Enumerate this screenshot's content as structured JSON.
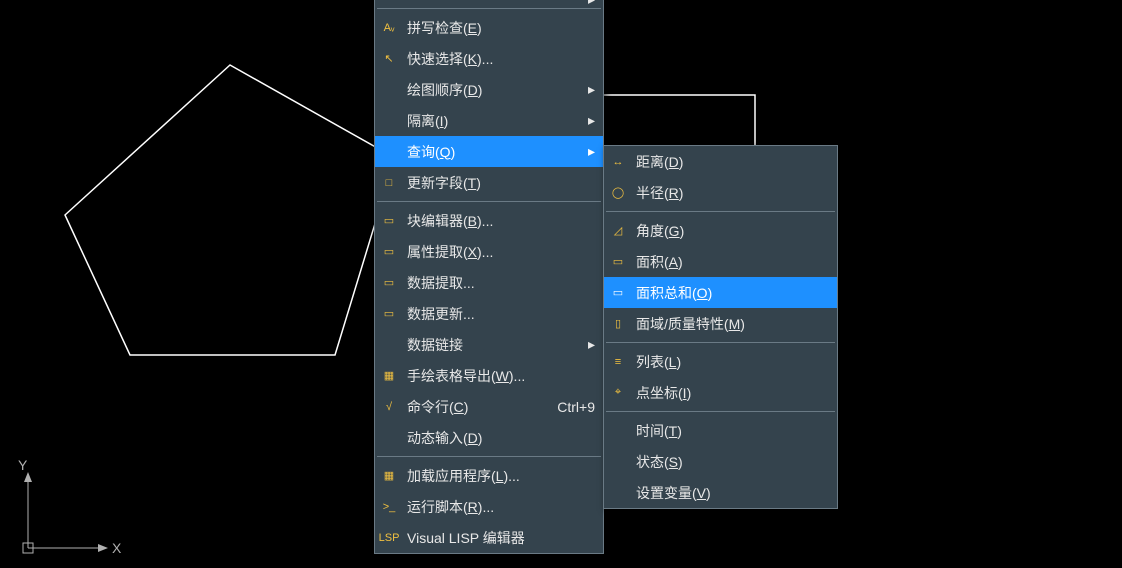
{
  "menu1": {
    "items": [
      {
        "icon": "",
        "label": "",
        "arrow": true,
        "top_cut": true
      },
      {
        "sep": true
      },
      {
        "icon": "spell-check-icon",
        "glyph": "Aᵥ",
        "label": "拼写检查(<u>E</u>)"
      },
      {
        "icon": "quick-select-icon",
        "glyph": "↖",
        "label": "快速选择(<u>K</u>)..."
      },
      {
        "icon": "",
        "label": "绘图顺序(<u>D</u>)",
        "arrow": true
      },
      {
        "icon": "",
        "label": "隔离(<u>I</u>)",
        "arrow": true
      },
      {
        "icon": "",
        "label": "查询(<u>Q</u>)",
        "arrow": true,
        "highlight": true
      },
      {
        "icon": "update-field-icon",
        "glyph": "□",
        "label": "更新字段(<u>T</u>)"
      },
      {
        "sep": true
      },
      {
        "icon": "block-editor-icon",
        "glyph": "▭",
        "label": "块编辑器(<u>B</u>)..."
      },
      {
        "icon": "attribute-extract-icon",
        "glyph": "▭",
        "label": "属性提取(<u>X</u>)..."
      },
      {
        "icon": "data-extract-icon",
        "glyph": "▭",
        "label": "数据提取..."
      },
      {
        "icon": "data-update-icon",
        "glyph": "▭",
        "label": "数据更新..."
      },
      {
        "icon": "",
        "label": "数据链接",
        "arrow": true
      },
      {
        "icon": "table-export-icon",
        "glyph": "▦",
        "label": "手绘表格导出(<u>W</u>)..."
      },
      {
        "icon": "command-line-icon",
        "glyph": "√",
        "label": "命令行(<u>C</u>)",
        "shortcut": "Ctrl+9"
      },
      {
        "icon": "",
        "label": "动态输入(<u>D</u>)"
      },
      {
        "sep": true
      },
      {
        "icon": "load-app-icon",
        "glyph": "▦",
        "label": "加载应用程序(<u>L</u>)..."
      },
      {
        "icon": "run-script-icon",
        "glyph": ">_",
        "label": "运行脚本(<u>R</u>)..."
      },
      {
        "icon": "vlisp-icon",
        "glyph": "LSP",
        "label": "Visual LISP 编辑器"
      }
    ]
  },
  "menu2": {
    "items": [
      {
        "icon": "distance-icon",
        "glyph": "↔",
        "label": "距离(<u>D</u>)"
      },
      {
        "icon": "radius-icon",
        "glyph": "◯",
        "label": "半径(<u>R</u>)"
      },
      {
        "sep": true
      },
      {
        "icon": "angle-icon",
        "glyph": "◿",
        "label": "角度(<u>G</u>)"
      },
      {
        "icon": "area-icon",
        "glyph": "▭",
        "label": "面积(<u>A</u>)"
      },
      {
        "icon": "area-sum-icon",
        "glyph": "▭",
        "label": "面积总和(<u>O</u>)",
        "highlight": true
      },
      {
        "icon": "region-mass-icon",
        "glyph": "▯",
        "label": "面域/质量特性(<u>M</u>)"
      },
      {
        "sep": true
      },
      {
        "icon": "list-icon",
        "glyph": "≡",
        "label": "列表(<u>L</u>)"
      },
      {
        "icon": "point-coord-icon",
        "glyph": "⌖",
        "label": "点坐标(<u>I</u>)"
      },
      {
        "sep": true
      },
      {
        "icon": "",
        "label": "时间(<u>T</u>)"
      },
      {
        "icon": "",
        "label": "状态(<u>S</u>)"
      },
      {
        "icon": "",
        "label": "设置变量(<u>V</u>)"
      }
    ]
  },
  "axis": {
    "x": "X",
    "y": "Y"
  }
}
